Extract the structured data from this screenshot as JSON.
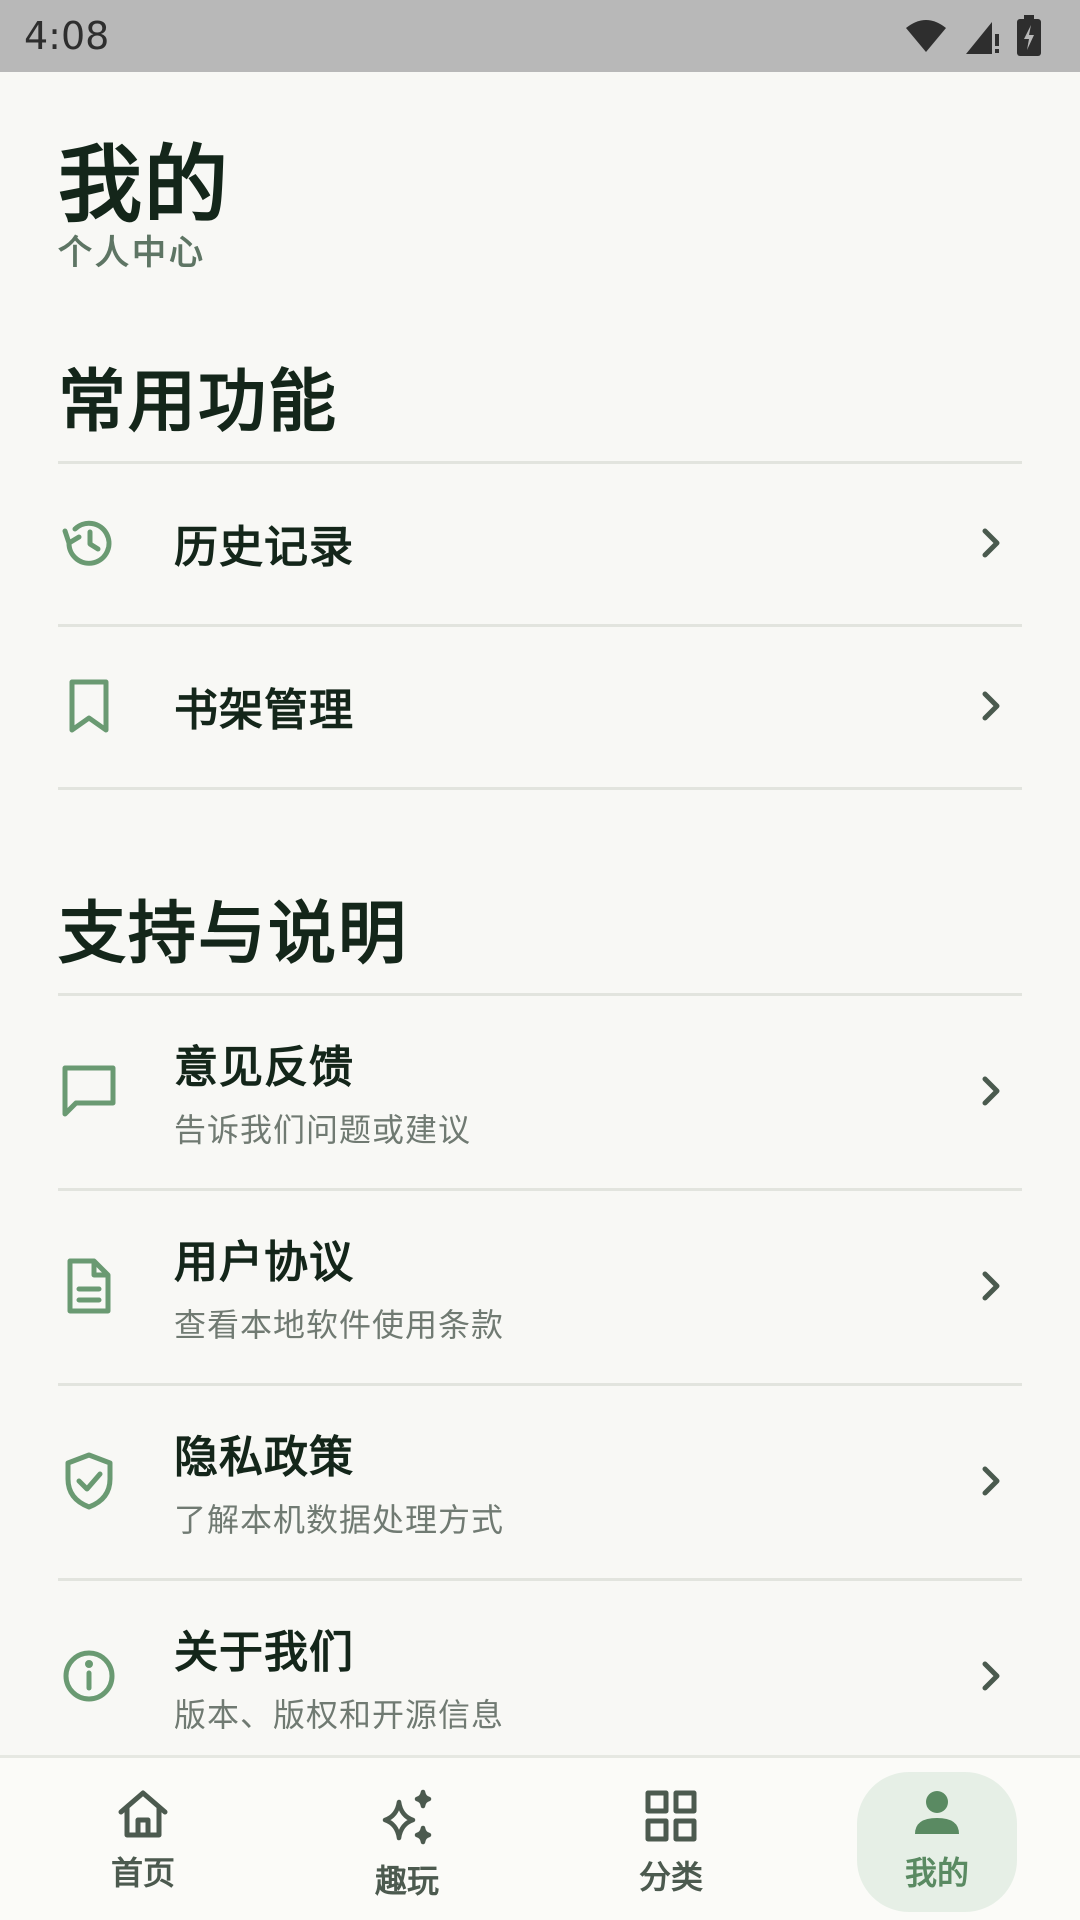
{
  "status_bar": {
    "time": "4:08"
  },
  "header": {
    "title": "我的",
    "subtitle": "个人中心"
  },
  "sections": [
    {
      "title": "常用功能",
      "items": [
        {
          "label": "历史记录",
          "icon": "history-icon"
        },
        {
          "label": "书架管理",
          "icon": "bookmark-icon"
        }
      ]
    },
    {
      "title": "支持与说明",
      "items": [
        {
          "label": "意见反馈",
          "sub": "告诉我们问题或建议",
          "icon": "message-icon"
        },
        {
          "label": "用户协议",
          "sub": "查看本地软件使用条款",
          "icon": "document-icon"
        },
        {
          "label": "隐私政策",
          "sub": "了解本机数据处理方式",
          "icon": "shield-check-icon"
        },
        {
          "label": "关于我们",
          "sub": "版本、版权和开源信息",
          "icon": "info-icon"
        }
      ]
    }
  ],
  "bottom_nav": [
    {
      "label": "首页",
      "icon": "home-icon"
    },
    {
      "label": "趣玩",
      "icon": "sparkles-icon"
    },
    {
      "label": "分类",
      "icon": "grid-icon"
    },
    {
      "label": "我的",
      "icon": "person-icon",
      "active": true
    }
  ],
  "colors": {
    "accent": "#6a9a72",
    "active_bg": "#e6efe6",
    "title": "#14261a"
  }
}
